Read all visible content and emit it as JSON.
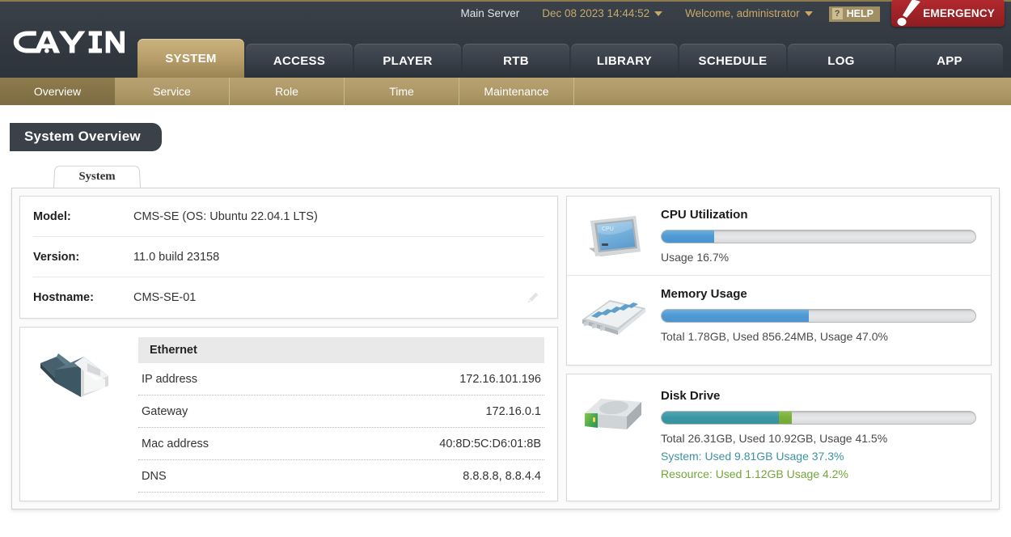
{
  "header": {
    "logo_text": "CAYIN",
    "server_label": "Main Server",
    "datetime": "Dec 08 2023 14:44:52",
    "welcome": "Welcome, administrator",
    "help_q": "?",
    "help_label": "HELP",
    "emergency_label": "EMERGENCY",
    "emergency_color": "#9e2226",
    "accent_color": "#c8a96a",
    "bar_color": "#353b43"
  },
  "main_nav": {
    "active": "SYSTEM",
    "items": [
      {
        "label": "SYSTEM"
      },
      {
        "label": "ACCESS"
      },
      {
        "label": "PLAYER"
      },
      {
        "label": "RTB"
      },
      {
        "label": "LIBRARY"
      },
      {
        "label": "SCHEDULE"
      },
      {
        "label": "LOG"
      },
      {
        "label": "APP"
      }
    ]
  },
  "sub_nav": {
    "active": "Overview",
    "items": [
      {
        "label": "Overview"
      },
      {
        "label": "Service"
      },
      {
        "label": "Role"
      },
      {
        "label": "Time"
      },
      {
        "label": "Maintenance"
      }
    ]
  },
  "page": {
    "title": "System Overview",
    "tabs": [
      {
        "label": "System"
      }
    ]
  },
  "system_info": {
    "rows": [
      {
        "key": "Model:",
        "value": "CMS-SE (OS: Ubuntu 22.04.1 LTS)",
        "editable": false
      },
      {
        "key": "Version:",
        "value": "11.0 build 23158",
        "editable": false
      },
      {
        "key": "Hostname:",
        "value": "CMS-SE-01",
        "editable": true
      }
    ]
  },
  "ethernet": {
    "title": "Ethernet",
    "icon": "ethernet-rj45-icon",
    "rows": [
      {
        "key": "IP address",
        "value": "172.16.101.196"
      },
      {
        "key": "Gateway",
        "value": "172.16.0.1"
      },
      {
        "key": "Mac address",
        "value": "40:8D:5C:D6:01:8B"
      },
      {
        "key": "DNS",
        "value": "8.8.8.8, 8.8.4.4"
      }
    ]
  },
  "cpu": {
    "title": "CPU Utilization",
    "icon": "cpu-chip-icon",
    "percent": 16.7,
    "bar_color": "#4f9ad4",
    "note": "Usage 16.7%"
  },
  "memory": {
    "title": "Memory Usage",
    "icon": "memory-ram-icon",
    "percent": 47.0,
    "bar_color": "#4f9ad4",
    "note": "Total 1.78GB, Used 856.24MB, Usage 47.0%"
  },
  "disk": {
    "title": "Disk Drive",
    "icon": "hard-disk-icon",
    "system_percent": 37.3,
    "resource_percent": 4.2,
    "system_color": "#3b97a6",
    "resource_color": "#7ab03a",
    "note_total": "Total 26.31GB, Used 10.92GB, Usage 41.5%",
    "note_system": "System: Used 9.81GB Usage 37.3%",
    "note_resource": "Resource: Used 1.12GB Usage 4.2%"
  }
}
